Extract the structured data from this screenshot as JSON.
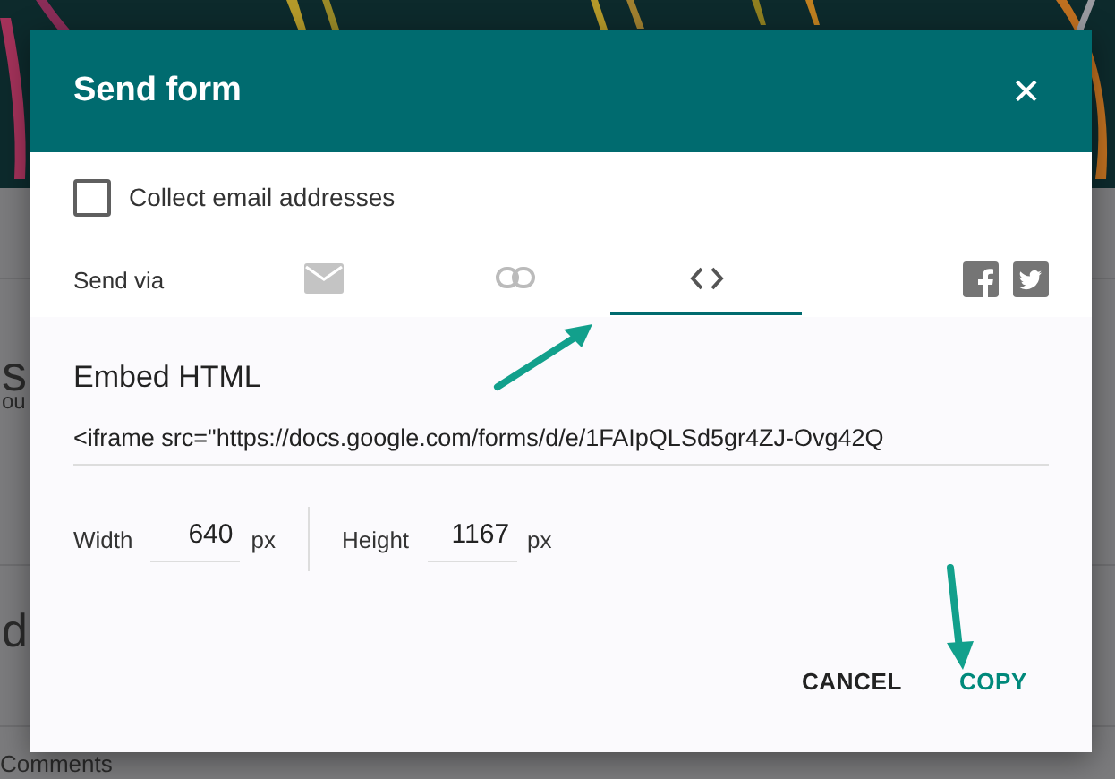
{
  "background": {
    "fragments": [
      "s",
      "ou",
      "d",
      "Comments"
    ]
  },
  "dialog": {
    "title": "Send form",
    "close": "✕",
    "collect_email": {
      "label": "Collect email addresses",
      "checked": false
    },
    "send_via": {
      "label": "Send via",
      "tabs": [
        {
          "kind": "email",
          "selected": false
        },
        {
          "kind": "link",
          "selected": false
        },
        {
          "kind": "embed",
          "selected": true
        }
      ],
      "social": [
        {
          "kind": "facebook"
        },
        {
          "kind": "twitter"
        }
      ]
    },
    "embed": {
      "heading": "Embed HTML",
      "code": "<iframe src=\"https://docs.google.com/forms/d/e/1FAIpQLSd5gr4ZJ-Ovg42Q",
      "width": {
        "label": "Width",
        "value": "640",
        "unit": "px"
      },
      "height": {
        "label": "Height",
        "value": "1167",
        "unit": "px"
      }
    },
    "buttons": [
      {
        "label": "CANCEL",
        "kind": "secondary"
      },
      {
        "label": "COPY",
        "kind": "primary"
      }
    ]
  },
  "annotations": [
    {
      "kind": "arrow"
    },
    {
      "kind": "arrow"
    }
  ]
}
